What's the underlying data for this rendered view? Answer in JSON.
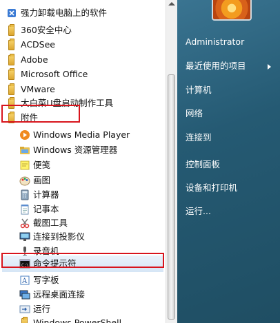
{
  "programs": [
    {
      "label": "强力卸载电脑上的软件",
      "icon": "uninstall-icon"
    },
    {
      "label": "360安全中心",
      "icon": "folder-icon"
    },
    {
      "label": "ACDSee",
      "icon": "folder-icon"
    },
    {
      "label": "Adobe",
      "icon": "folder-icon"
    },
    {
      "label": "Microsoft Office",
      "icon": "folder-icon"
    },
    {
      "label": "VMware",
      "icon": "folder-icon"
    },
    {
      "label": "大白菜U盘启动制作工具",
      "icon": "folder-icon"
    },
    {
      "label": "附件",
      "icon": "folder-icon"
    },
    {
      "label": "Windows Media Player",
      "icon": "media-player-icon"
    },
    {
      "label": "Windows 资源管理器",
      "icon": "explorer-icon"
    },
    {
      "label": "便笺",
      "icon": "sticky-notes-icon"
    },
    {
      "label": "画图",
      "icon": "paint-icon"
    },
    {
      "label": "计算器",
      "icon": "calculator-icon"
    },
    {
      "label": "记事本",
      "icon": "notepad-icon"
    },
    {
      "label": "截图工具",
      "icon": "snipping-tool-icon"
    },
    {
      "label": "连接到投影仪",
      "icon": "projector-icon"
    },
    {
      "label": "录音机",
      "icon": "microphone-icon"
    },
    {
      "label": "命令提示符",
      "icon": "command-prompt-icon"
    },
    {
      "label": "写字板",
      "icon": "wordpad-icon"
    },
    {
      "label": "远程桌面连接",
      "icon": "remote-desktop-icon"
    },
    {
      "label": "运行",
      "icon": "run-icon"
    },
    {
      "label": "Windows PowerShell",
      "icon": "folder-icon"
    }
  ],
  "right_pane": {
    "user_name": "Administrator",
    "recent_items": "最近使用的项目",
    "computer": "计算机",
    "network": "网络",
    "connect_to": "连接到",
    "control_panel": "控制面板",
    "devices_printers": "设备和打印机",
    "run": "运行..."
  },
  "colors": {
    "highlight_box": "#d8141c",
    "right_pane": "#255a73"
  }
}
